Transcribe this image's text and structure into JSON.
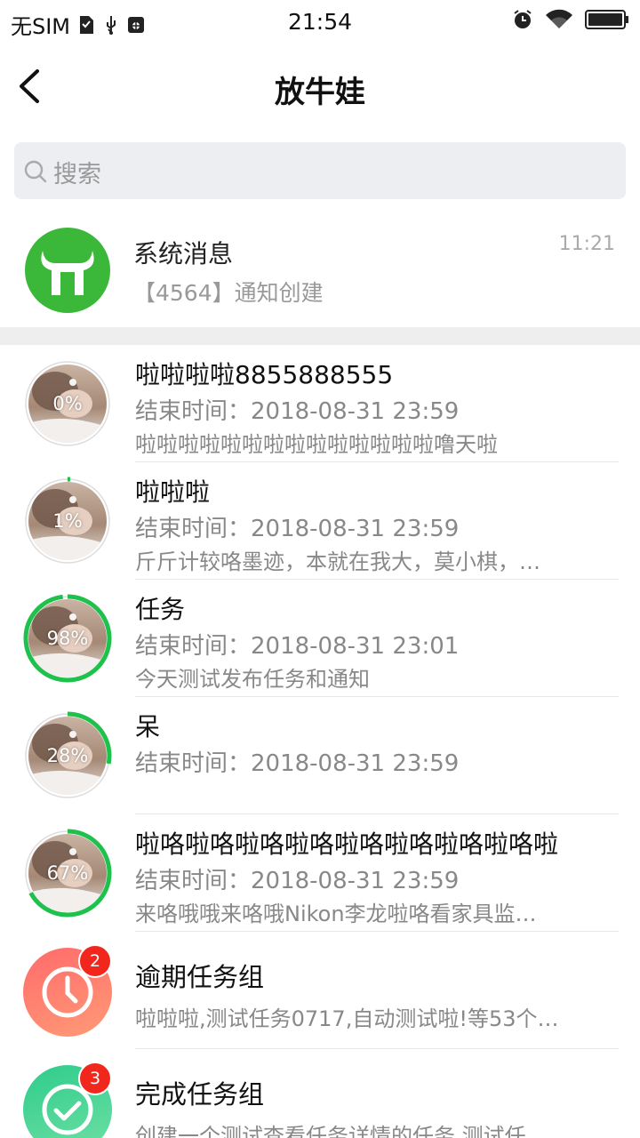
{
  "status_bar": {
    "carrier": "无SIM",
    "time": "21:54",
    "left_icons": [
      "sim-card-icon",
      "usb-icon",
      "debug-icon"
    ],
    "right_icons": [
      "alarm-icon",
      "wifi-icon",
      "battery-icon"
    ]
  },
  "nav": {
    "title": "放牛娃",
    "back_icon": "chevron-left-icon"
  },
  "search": {
    "placeholder": "搜索",
    "icon": "search-icon"
  },
  "system_message": {
    "title": "系统消息",
    "subtitle": "【4564】通知创建",
    "time": "11:21",
    "avatar_color": "#3bb83a"
  },
  "tasks": [
    {
      "title": "啦啦啦啦8855888555",
      "end_time": "结束时间：2018-08-31 23:59",
      "desc": "啦啦啦啦啦啦啦啦啦啦啦啦啦啦噜天啦",
      "progress_label": "0%",
      "progress": 0.0
    },
    {
      "title": "啦啦啦",
      "end_time": "结束时间：2018-08-31 23:59",
      "desc": "斤斤计较咯墨迹，本就在我大，莫小棋，…",
      "progress_label": "1%",
      "progress": 0.01
    },
    {
      "title": "任务",
      "end_time": "结束时间：2018-08-31 23:01",
      "desc": "今天测试发布任务和通知",
      "progress_label": "98%",
      "progress": 0.98
    },
    {
      "title": "呆",
      "end_time": "结束时间：2018-08-31 23:59",
      "desc": "",
      "progress_label": "28%",
      "progress": 0.28
    },
    {
      "title": "啦咯啦咯啦咯啦咯啦咯啦咯啦咯啦咯啦",
      "end_time": "结束时间：2018-08-31 23:59",
      "desc": "来咯哦哦来咯哦Nikon李龙啦咯看家具监…",
      "progress_label": "67%",
      "progress": 0.67
    }
  ],
  "groups": [
    {
      "title": "逾期任务组",
      "desc": "啦啦啦,测试任务0717,自动测试啦!等53个…",
      "badge": "2",
      "icon": "clock-icon",
      "color_from": "#ff6b6b",
      "color_to": "#ff9a76"
    },
    {
      "title": "完成任务组",
      "desc": "创建一个测试查看任务详情的任务,测试任…",
      "badge": "3",
      "icon": "check-circle-icon",
      "color_from": "#2ecc8b",
      "color_to": "#6fe0a5"
    }
  ],
  "colors": {
    "progress_ring": "#1ec14b",
    "ring_track": "#dddddd",
    "badge": "#f1271d"
  }
}
